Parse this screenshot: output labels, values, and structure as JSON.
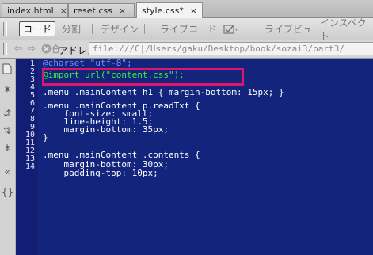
{
  "tabs": [
    {
      "label": "index.html",
      "active": false,
      "close": "×"
    },
    {
      "label": "reset.css",
      "active": false,
      "close": "×"
    },
    {
      "label": "style.css*",
      "active": true,
      "close": "×"
    }
  ],
  "toolbar": {
    "code": "コード",
    "split": "分割",
    "design": "デザイン",
    "live_code": "ライブコード",
    "live_view": "ライブビュー",
    "inspect": "インスペクト"
  },
  "address": {
    "label": "アドレス:",
    "value": "file:///C|/Users/gaku/Desktop/book/sozai3/part3/"
  },
  "gutter_icons": [
    "file-icon",
    "settings-icon",
    "collapse-icon",
    "expand-icon",
    "select-icon",
    "indent-icon",
    "brace-icon"
  ],
  "line_numbers": [
    "1",
    "2",
    "3",
    "4",
    "5",
    "6",
    "7",
    "8",
    "9",
    "10",
    "11",
    "12",
    "13",
    "14"
  ],
  "code_lines": [
    {
      "text": "@charset \"utf-8\";",
      "kind": "comment"
    },
    {
      "text": "@import url(\"content.css\");",
      "kind": "import"
    },
    {
      "text": "",
      "kind": "normal"
    },
    {
      "text": ".menu .mainContent h1 { margin-bottom: 15px; }",
      "kind": "normal"
    },
    {
      "text": "",
      "kind": "normal"
    },
    {
      "text": ".menu .mainContent p.readTxt {",
      "kind": "normal"
    },
    {
      "text": "    font-size: small;",
      "kind": "normal"
    },
    {
      "text": "    line-height: 1.5;",
      "kind": "normal"
    },
    {
      "text": "    margin-bottom: 35px;",
      "kind": "normal"
    },
    {
      "text": "}",
      "kind": "normal"
    },
    {
      "text": "",
      "kind": "normal"
    },
    {
      "text": ".menu .mainContent .contents {",
      "kind": "normal"
    },
    {
      "text": "    margin-bottom: 30px;",
      "kind": "normal"
    },
    {
      "text": "    padding-top: 10px;",
      "kind": "normal"
    }
  ],
  "colors": {
    "code_bg": "#12247c",
    "highlight_border": "#e0156e",
    "import_text": "#3ef03e"
  }
}
